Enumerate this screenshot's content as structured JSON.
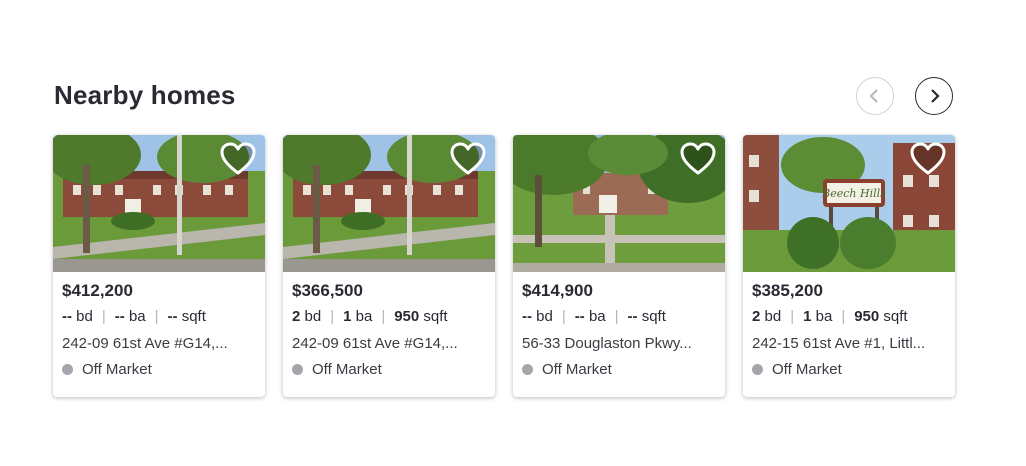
{
  "section": {
    "title": "Nearby homes",
    "prev_icon": "chevron-left-icon",
    "next_icon": "chevron-right-icon"
  },
  "cards": [
    {
      "price": "$412,200",
      "beds": "--",
      "beds_unit": "bd",
      "baths": "--",
      "baths_unit": "ba",
      "sqft": "--",
      "sqft_unit": "sqft",
      "address": "242-09 61st Ave #G14,...",
      "status": "Off Market",
      "favorite_icon": "heart-outline-icon"
    },
    {
      "price": "$366,500",
      "beds": "2",
      "beds_unit": "bd",
      "baths": "1",
      "baths_unit": "ba",
      "sqft": "950",
      "sqft_unit": "sqft",
      "address": "242-09 61st Ave #G14,...",
      "status": "Off Market",
      "favorite_icon": "heart-outline-icon"
    },
    {
      "price": "$414,900",
      "beds": "--",
      "beds_unit": "bd",
      "baths": "--",
      "baths_unit": "ba",
      "sqft": "--",
      "sqft_unit": "sqft",
      "address": "56-33 Douglaston Pkwy...",
      "status": "Off Market",
      "favorite_icon": "heart-outline-icon"
    },
    {
      "price": "$385,200",
      "beds": "2",
      "beds_unit": "bd",
      "baths": "1",
      "baths_unit": "ba",
      "sqft": "950",
      "sqft_unit": "sqft",
      "address": "242-15 61st Ave #1, Littl...",
      "status": "Off Market",
      "favorite_icon": "heart-outline-icon",
      "photo_sign_text": "Beech Hills"
    }
  ],
  "colors": {
    "status_dot": "#a5a5ab",
    "text": "#2a2a33"
  }
}
